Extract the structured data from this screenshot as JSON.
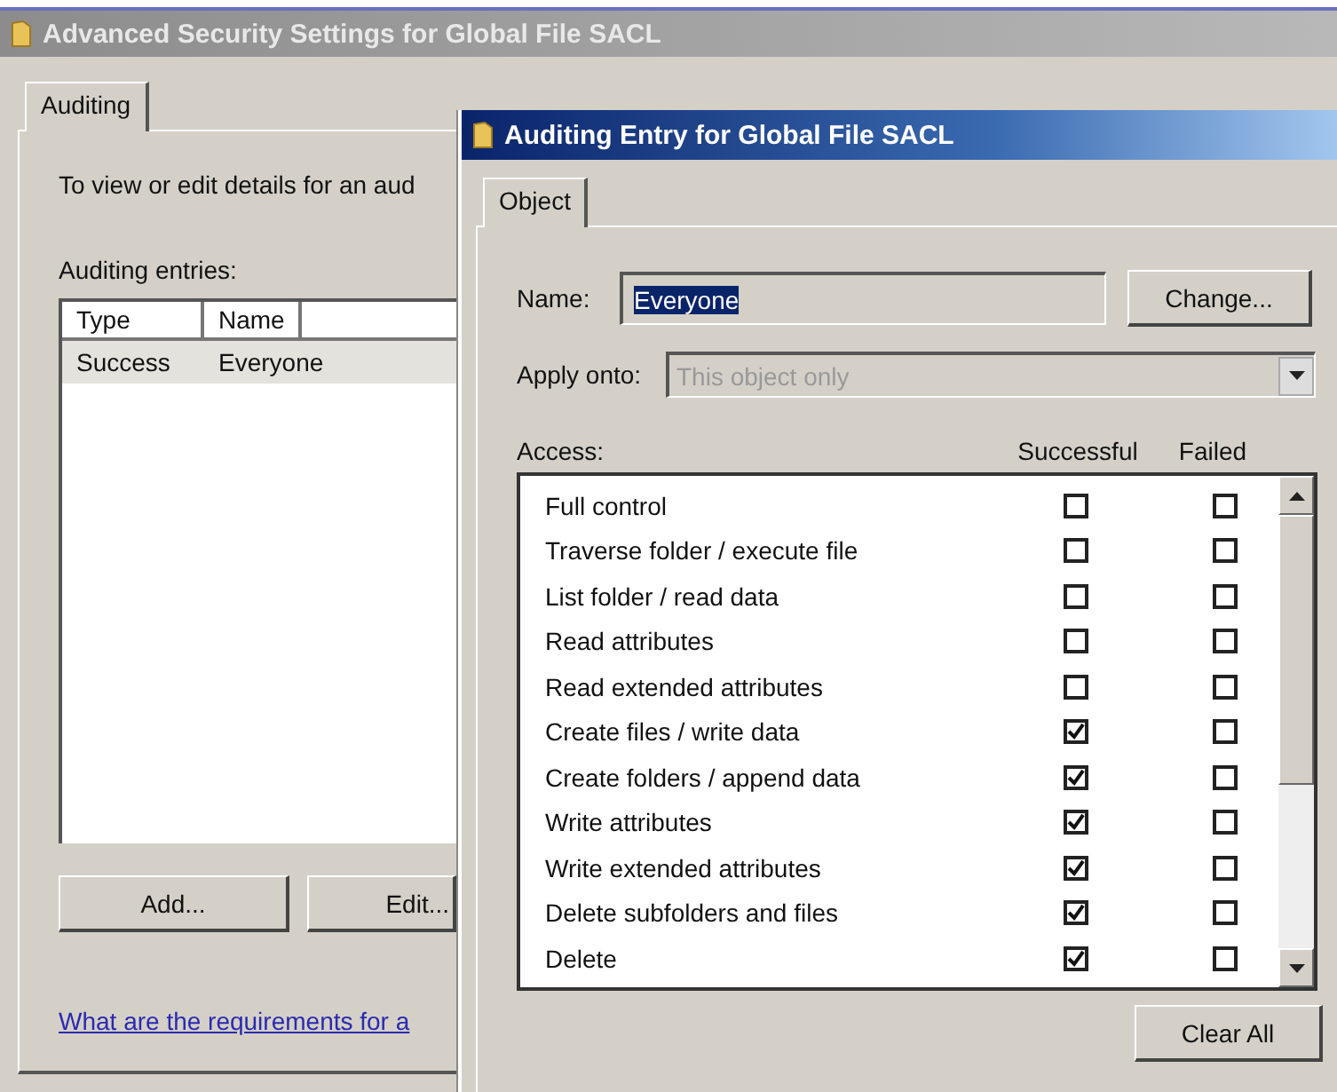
{
  "main_window": {
    "title": "Advanced Security Settings for Global File SACL",
    "tabs": [
      {
        "label": "Auditing",
        "selected": true
      }
    ],
    "description": "To view or edit details for an aud",
    "entries_label": "Auditing entries:",
    "columns": [
      "Type",
      "Name"
    ],
    "rows": [
      {
        "cells": [
          "Success",
          "Everyone"
        ],
        "selected": true
      }
    ],
    "buttons": [
      "Add...",
      "Edit..."
    ],
    "help_link": "What are the requirements for a"
  },
  "dialog": {
    "title": "Auditing Entry for Global File SACL",
    "tabs": [
      {
        "label": "Object",
        "selected": true
      }
    ],
    "name_label": "Name:",
    "name_value": "Everyone",
    "change_button": "Change...",
    "apply_label": "Apply onto:",
    "apply_value": "This object only",
    "apply_disabled": true,
    "access_label": "Access:",
    "columns": [
      "Successful",
      "Failed"
    ],
    "permissions": [
      {
        "label": "Full control",
        "successful": false,
        "failed": false
      },
      {
        "label": "Traverse folder / execute file",
        "successful": false,
        "failed": false
      },
      {
        "label": "List folder / read data",
        "successful": false,
        "failed": false
      },
      {
        "label": "Read attributes",
        "successful": false,
        "failed": false
      },
      {
        "label": "Read extended attributes",
        "successful": false,
        "failed": false
      },
      {
        "label": "Create files / write data",
        "successful": true,
        "failed": false
      },
      {
        "label": "Create folders / append data",
        "successful": true,
        "failed": false
      },
      {
        "label": "Write attributes",
        "successful": true,
        "failed": false
      },
      {
        "label": "Write extended attributes",
        "successful": true,
        "failed": false
      },
      {
        "label": "Delete subfolders and files",
        "successful": true,
        "failed": false
      },
      {
        "label": "Delete",
        "successful": true,
        "failed": false
      }
    ],
    "clear_button": "Clear All"
  }
}
